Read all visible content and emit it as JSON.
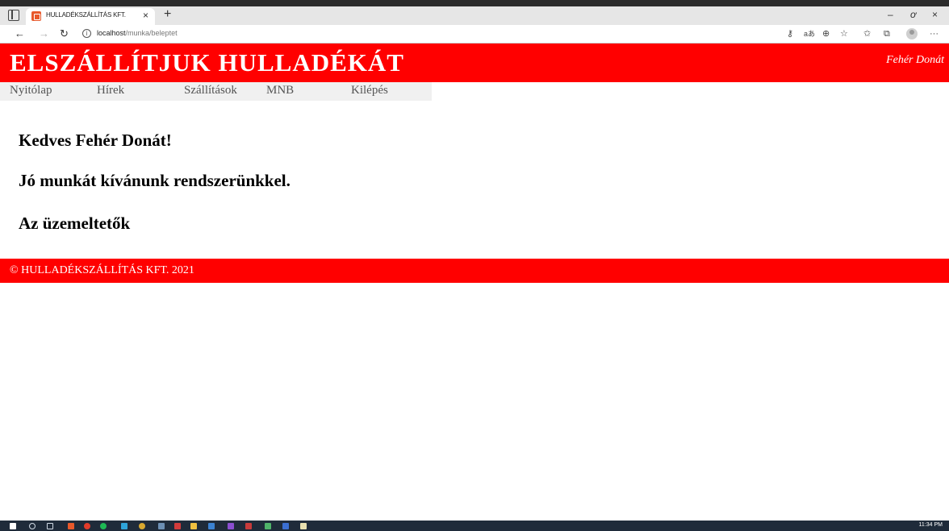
{
  "browser": {
    "tab_title": "HULLADÉKSZÁLLÍTÁS KFT.",
    "tab_close": "×",
    "new_tab": "+",
    "url_host": "localhost",
    "url_path": "/munka/beleptet",
    "window_controls": {
      "minimize": "–",
      "restore": "ơ",
      "close": "×"
    },
    "toolbar_icons": [
      "key-icon",
      "read-aloud-icon",
      "zoom-icon",
      "favorite-add-icon",
      "favorites-icon",
      "collections-icon",
      "profile-icon",
      "more-icon"
    ]
  },
  "header": {
    "title": "ELSZÁLLÍTJUK HULLADÉKÁT",
    "user": "Fehér Donát",
    "background": "#ff0000"
  },
  "nav": {
    "items": [
      {
        "label": "Nyitólap"
      },
      {
        "label": "Hírek"
      },
      {
        "label": "Szállítások"
      },
      {
        "label": "MNB"
      },
      {
        "label": "Kilépés"
      }
    ]
  },
  "main": {
    "greeting": "Kedves Fehér Donát!",
    "wish": "Jó munkát kívánunk rendszerünkkel.",
    "signature": "Az üzemeltetők"
  },
  "footer": {
    "text": "© HULLADÉKSZÁLLÍTÁS KFT. 2021"
  },
  "taskbar": {
    "clock": "11:34 PM"
  }
}
